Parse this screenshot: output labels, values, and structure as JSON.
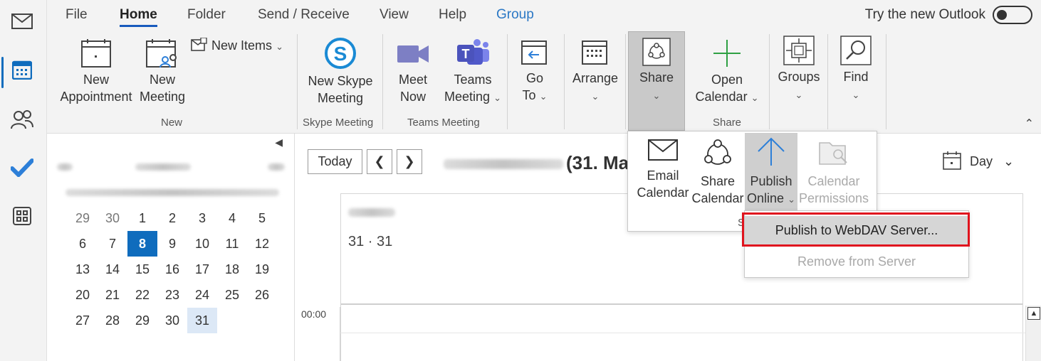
{
  "ribbon": {
    "tabs": [
      "File",
      "Home",
      "Folder",
      "Send / Receive",
      "View",
      "Help",
      "Group"
    ],
    "try_new_outlook": "Try the new Outlook",
    "buttons": {
      "new_appointment": [
        "New",
        "Appointment"
      ],
      "new_meeting": [
        "New",
        "Meeting"
      ],
      "new_items": "New Items",
      "new_skype_meeting": [
        "New Skype",
        "Meeting"
      ],
      "meet_now": [
        "Meet",
        "Now"
      ],
      "teams_meeting": [
        "Teams",
        "Meeting"
      ],
      "go_to": [
        "Go",
        "To"
      ],
      "arrange": "Arrange",
      "share": "Share",
      "open_calendar": [
        "Open",
        "Calendar"
      ],
      "groups": "Groups",
      "find": "Find"
    },
    "group_labels": {
      "new": "New",
      "skype": "Skype Meeting",
      "teams": "Teams Meeting",
      "share": "Share"
    }
  },
  "navigator": {
    "rows": [
      [
        "29",
        "30",
        "1",
        "2",
        "3",
        "4",
        "5"
      ],
      [
        "6",
        "7",
        "8",
        "9",
        "10",
        "11",
        "12"
      ],
      [
        "13",
        "14",
        "15",
        "16",
        "17",
        "18",
        "19"
      ],
      [
        "20",
        "21",
        "22",
        "23",
        "24",
        "25",
        "26"
      ],
      [
        "27",
        "28",
        "29",
        "30",
        "31"
      ]
    ],
    "today": "8",
    "selected": "31"
  },
  "main": {
    "today_label": "Today",
    "date_title": "(31. Ma",
    "view_label": "Day",
    "day_header": "31 · 31",
    "time_label": "00:00"
  },
  "share_menu": {
    "email_calendar": [
      "Email",
      "Calendar"
    ],
    "share_calendar": [
      "Share",
      "Calendar"
    ],
    "publish_online": [
      "Publish",
      "Online"
    ],
    "calendar_permissions": [
      "Calendar",
      "Permissions"
    ],
    "group_label_partial": "S"
  },
  "submenu": {
    "publish_webdav": "Publish to WebDAV Server...",
    "remove_from_server": "Remove from Server"
  },
  "colors": {
    "accent": "#0f6cbd",
    "highlight_box": "#e0141e",
    "group_tab": "#2b78c5"
  }
}
